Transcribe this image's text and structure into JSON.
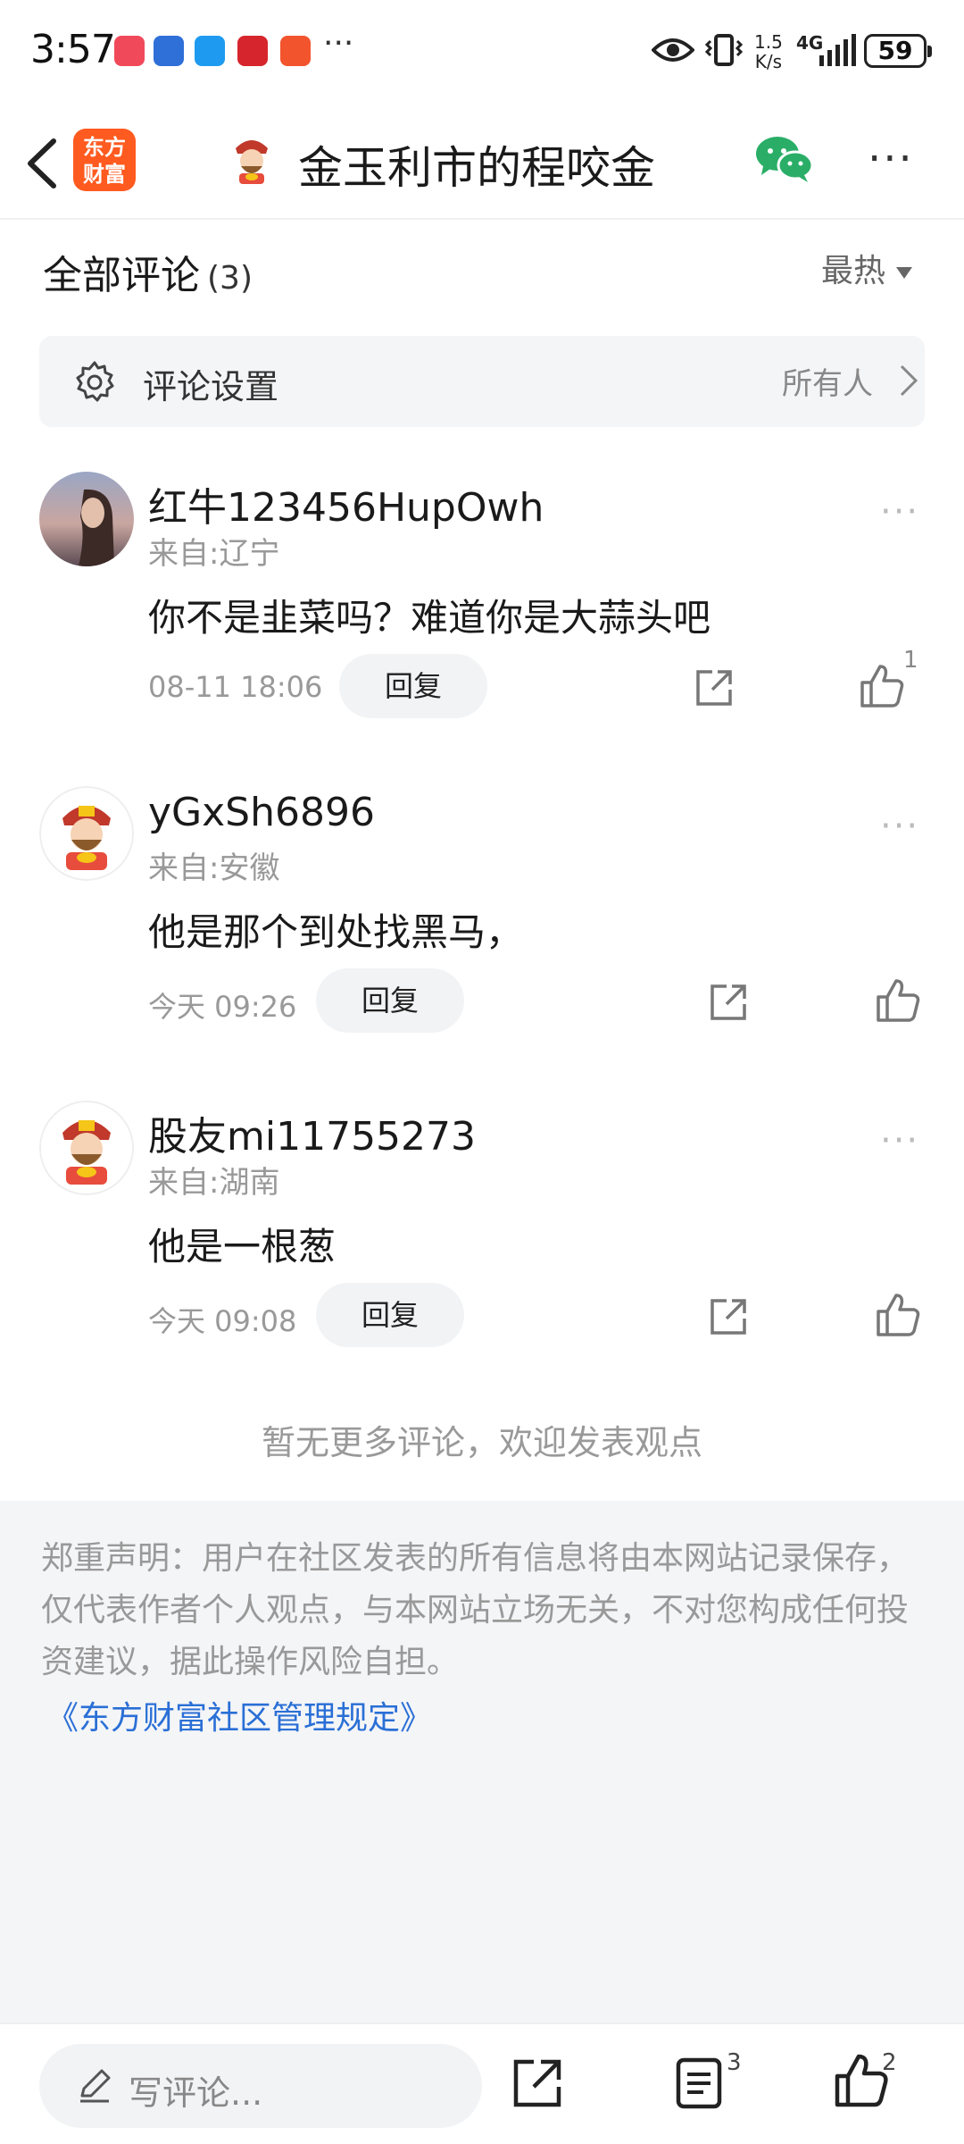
{
  "status_bar": {
    "time": "3:57",
    "more": "···",
    "net_speed_value": "1.5",
    "net_speed_unit": "K/s",
    "network": "4G",
    "battery": "59"
  },
  "header": {
    "logo_line1": "东方",
    "logo_line2": "财富",
    "title": "金玉利市的程咬金",
    "more": "···"
  },
  "section": {
    "title": "全部评论",
    "count": "(3)",
    "sort_label": "最热"
  },
  "settings": {
    "label": "评论设置",
    "value": "所有人"
  },
  "comments": [
    {
      "name": "红牛123456HupOwh",
      "location": "来自:辽宁",
      "text": "你不是韭菜吗？难道你是大蒜头吧",
      "time": "08-11 18:06",
      "reply": "回复",
      "likes": "1",
      "more": "···"
    },
    {
      "name": "yGxSh6896",
      "location": "来自:安徽",
      "text": "他是那个到处找黑马，",
      "time": "今天 09:26",
      "reply": "回复",
      "likes": "",
      "more": "···"
    },
    {
      "name": "股友mi11755273",
      "location": "来自:湖南",
      "text": "他是一根葱",
      "time": "今天 09:08",
      "reply": "回复",
      "likes": "",
      "more": "···"
    }
  ],
  "no_more": "暂无更多评论，欢迎发表观点",
  "disclaimer": {
    "text": "郑重声明：用户在社区发表的所有信息将由本网站记录保存，仅代表作者个人观点，与本网站立场无关，不对您构成任何投资建议，据此操作风险自担。",
    "link": "《东方财富社区管理规定》"
  },
  "bottom_bar": {
    "input_placeholder": "写评论...",
    "comment_count": "3",
    "like_count": "2"
  },
  "colors": {
    "brand": "#ff5a1f",
    "link": "#2a6fd6",
    "wechat": "#2aae67",
    "muted": "#999999"
  },
  "icons": [
    "back-arrow-icon",
    "wechat-icon",
    "gear-icon",
    "chevron-right-icon",
    "share-icon",
    "thumbs-up-icon",
    "pen-icon",
    "list-icon"
  ]
}
